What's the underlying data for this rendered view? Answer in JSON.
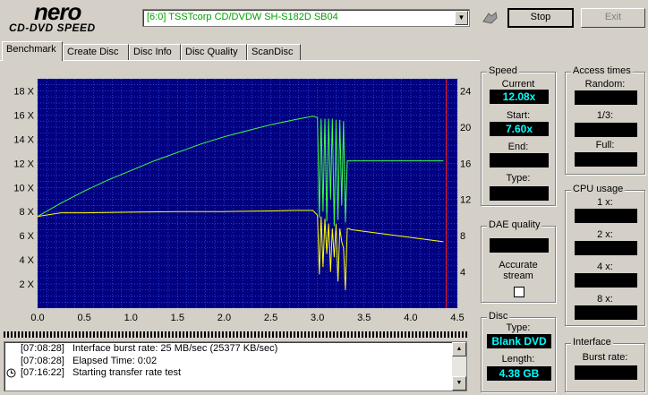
{
  "logo": {
    "brand": "nero",
    "product": "CD-DVD SPEED"
  },
  "drive": {
    "selected": "[6:0]   TSSTcorp CD/DVDW SH-S182D SB04"
  },
  "buttons": {
    "stop": "Stop",
    "exit": "Exit"
  },
  "tabs": [
    "Benchmark",
    "Create Disc",
    "Disc Info",
    "Disc Quality",
    "ScanDisc"
  ],
  "chart_data": {
    "type": "line",
    "x_ticks": [
      "0.0",
      "0.5",
      "1.0",
      "1.5",
      "2.0",
      "2.5",
      "3.0",
      "3.5",
      "4.0",
      "4.5"
    ],
    "y_left_ticks": [
      "2 X",
      "4 X",
      "6 X",
      "8 X",
      "10 X",
      "12 X",
      "14 X",
      "16 X",
      "18 X"
    ],
    "y_right_ticks": [
      "4",
      "8",
      "12",
      "16",
      "20",
      "24"
    ],
    "xlim": [
      0,
      4.5
    ],
    "ylim_left": [
      0,
      19
    ],
    "ylim_right": [
      0,
      25.33
    ],
    "max_capacity_marker_x": 4.38,
    "grid": true,
    "colors": {
      "background": "#000080",
      "grid": "#4060ff",
      "speed": "#40ff40",
      "rpm": "#ffff00",
      "marker": "#ff2020"
    },
    "series": [
      {
        "color": "#40ff40",
        "x": [
          0.0,
          0.25,
          0.5,
          0.75,
          1.0,
          1.25,
          1.5,
          1.75,
          2.0,
          2.25,
          2.5,
          2.75,
          2.95,
          3.0,
          3.02,
          3.04,
          3.06,
          3.08,
          3.1,
          3.12,
          3.14,
          3.16,
          3.18,
          3.2,
          3.22,
          3.24,
          3.26,
          3.28,
          3.3,
          3.32,
          3.34,
          3.36,
          4.35
        ],
        "y": [
          7.6,
          8.7,
          9.7,
          10.6,
          11.4,
          12.2,
          12.9,
          13.6,
          14.2,
          14.7,
          15.2,
          15.6,
          15.9,
          15.8,
          7.5,
          15.7,
          8.0,
          15.7,
          7.2,
          15.7,
          9.0,
          15.7,
          6.8,
          15.6,
          7.3,
          15.6,
          8.5,
          15.5,
          7.1,
          12.2,
          12.2,
          12.2,
          12.2
        ]
      },
      {
        "color": "#ffff00",
        "x": [
          0.0,
          0.25,
          0.5,
          1.0,
          1.5,
          2.0,
          2.5,
          2.75,
          2.95,
          3.0,
          3.02,
          3.04,
          3.06,
          3.08,
          3.1,
          3.12,
          3.14,
          3.16,
          3.18,
          3.2,
          3.22,
          3.24,
          3.26,
          3.28,
          3.3,
          3.32,
          3.34,
          3.36,
          4.35
        ],
        "y": [
          7.6,
          7.9,
          7.9,
          7.95,
          8.0,
          8.0,
          8.05,
          8.1,
          8.1,
          7.7,
          2.8,
          7.6,
          3.4,
          7.4,
          4.5,
          7.0,
          3.0,
          6.6,
          4.2,
          7.0,
          2.2,
          6.6,
          5.5,
          5.0,
          1.5,
          6.6,
          6.6,
          6.5,
          5.5
        ]
      }
    ]
  },
  "log": {
    "entries": [
      {
        "time": "[07:08:28]",
        "message": "Interface burst rate: 25 MB/sec (25377 KB/sec)"
      },
      {
        "time": "[07:08:28]",
        "message": "Elapsed Time:  0:02"
      },
      {
        "time": "[07:16:22]",
        "message": "Starting transfer rate test"
      }
    ]
  },
  "speed": {
    "title": "Speed",
    "current_label": "Current",
    "current_value": "12.08x",
    "start_label": "Start:",
    "start_value": "7.60x",
    "end_label": "End:",
    "end_value": "",
    "type_label": "Type:",
    "type_value": ""
  },
  "access": {
    "title": "Access times",
    "random_label": "Random:",
    "third_label": "1/3:",
    "full_label": "Full:"
  },
  "cpu": {
    "title": "CPU usage",
    "x1": "1 x:",
    "x2": "2 x:",
    "x4": "4 x:",
    "x8": "8 x:"
  },
  "dae": {
    "title": "DAE quality",
    "accurate_label": "Accurate\nstream"
  },
  "disc": {
    "title": "Disc",
    "type_label": "Type:",
    "type_value": "Blank DVD",
    "length_label": "Length:",
    "length_value": "4.38 GB"
  },
  "interface": {
    "title": "Interface",
    "burst_label": "Burst rate:"
  }
}
